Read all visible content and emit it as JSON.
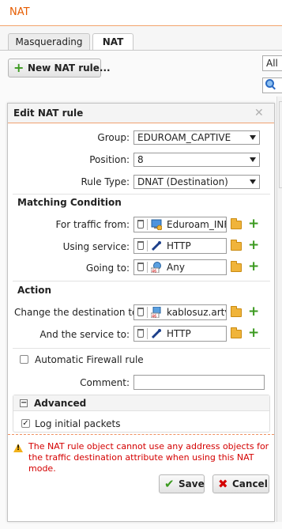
{
  "app": {
    "title": "NAT"
  },
  "tabs": [
    {
      "label": "Masquerading",
      "active": false
    },
    {
      "label": "NAT",
      "active": true
    }
  ],
  "toolbar": {
    "new_rule_label": "New NAT rule...",
    "filter_value": "All"
  },
  "dialog": {
    "title": "Edit NAT rule",
    "group": {
      "label": "Group:",
      "value": "EDUROAM_CAPTIVE"
    },
    "position": {
      "label": "Position:",
      "value": "8"
    },
    "rule_type": {
      "label": "Rule Type:",
      "value": "DNAT (Destination)"
    },
    "matching": {
      "heading": "Matching Condition",
      "traffic_from": {
        "label": "For traffic from:",
        "value": "Eduroam_INF",
        "icon": "network-icon"
      },
      "service": {
        "label": "Using service:",
        "value": "HTTP",
        "icon": "service-icon"
      },
      "going_to": {
        "label": "Going to:",
        "value": "Any",
        "icon": "any-ipv46-icon"
      }
    },
    "action": {
      "heading": "Action",
      "change_dest": {
        "label": "Change the destination to:",
        "value": "kablosuz.artv",
        "icon": "host-ipv46-icon"
      },
      "service_to": {
        "label": "And the service to:",
        "value": "HTTP",
        "icon": "service-icon"
      }
    },
    "auto_fw": {
      "label": "Automatic Firewall rule",
      "checked": false
    },
    "comment": {
      "label": "Comment:",
      "value": ""
    },
    "advanced": {
      "title": "Advanced",
      "log_initial": {
        "label": "Log initial packets",
        "checked": true
      }
    },
    "warning": "The NAT rule object cannot use any address objects for the traffic destination attribute when using this NAT mode.",
    "save_label": "Save",
    "cancel_label": "Cancel"
  },
  "colors": {
    "accent": "#e65c00",
    "warning_text": "#d40000",
    "plus_green": "#3b9a1f",
    "folder": "#f0b43a"
  }
}
